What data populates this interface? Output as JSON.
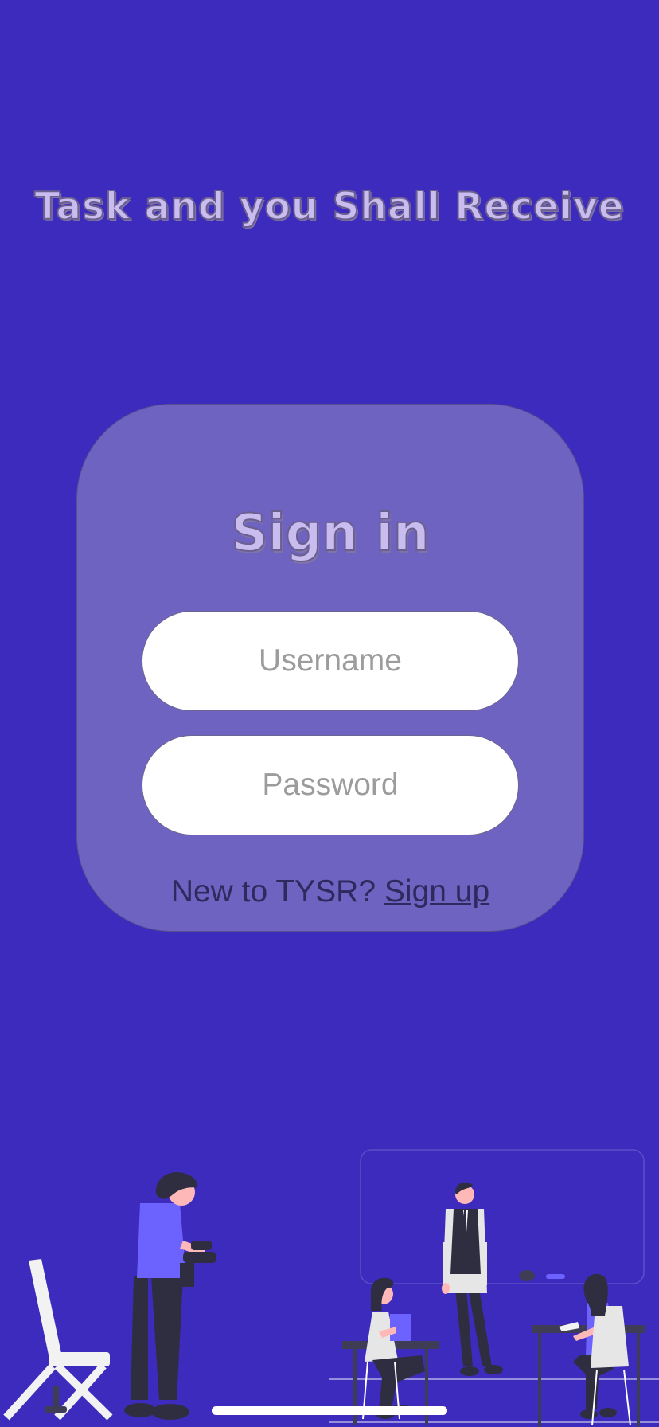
{
  "app": {
    "title": "Task and you Shall Receive"
  },
  "signin": {
    "heading": "Sign in",
    "username_placeholder": "Username",
    "password_placeholder": "Password",
    "new_user_prompt": "New to TYSR?",
    "signup_link": "Sign up"
  },
  "colors": {
    "background": "#3D2BBD",
    "card": "#6F63C1",
    "title_fill": "#C9BDF0",
    "accent_purple": "#6C63FF",
    "dark_figure": "#2F2E41"
  }
}
